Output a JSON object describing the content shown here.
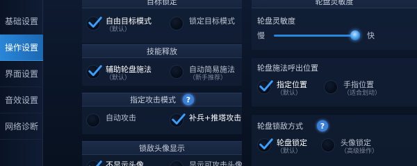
{
  "sidebar": {
    "items": [
      {
        "label": "基础设置",
        "active": false
      },
      {
        "label": "操作设置",
        "active": true
      },
      {
        "label": "界面设置",
        "active": false
      },
      {
        "label": "音效设置",
        "active": false
      },
      {
        "label": "网络诊断",
        "active": false
      }
    ]
  },
  "left": {
    "target_lock": {
      "title": "目标锁定",
      "options": [
        {
          "label": "自由目标模式",
          "sub": "（默认）",
          "checked": true
        },
        {
          "label": "锁定目标模式",
          "sub": "",
          "checked": false
        }
      ]
    },
    "skill_cast": {
      "title": "技能释放",
      "options": [
        {
          "label": "辅助轮盘施法",
          "sub": "（默认）",
          "checked": true
        },
        {
          "label": "自动简易施法",
          "sub": "（新手推荐）",
          "checked": false
        }
      ]
    },
    "attack_mode": {
      "title": "指定攻击模式",
      "help": "?",
      "options": [
        {
          "label": "自动攻击",
          "sub": "",
          "checked": false
        },
        {
          "label": "补兵+推塔攻击",
          "sub": "",
          "checked": true
        }
      ]
    },
    "enemy_avatar": {
      "title": "锁敌头像显示",
      "options": [
        {
          "label": "不显示头像",
          "checked": true
        },
        {
          "label": "显示可攻击头像",
          "checked": false
        }
      ]
    }
  },
  "right": {
    "wheel_sensitivity": {
      "title": "轮盘灵敏度",
      "label": "轮盘灵敏度",
      "slow_label": "慢",
      "fast_label": "快",
      "value": 0.93
    },
    "wheel_callout": {
      "title": "轮盘施法呼出位置",
      "options": [
        {
          "label": "指定位置",
          "sub": "（默认）",
          "checked": true
        },
        {
          "label": "手指位置",
          "sub": "（适合划动）",
          "checked": false
        }
      ]
    },
    "wheel_lock": {
      "title": "轮盘锁敌方式",
      "help": "?",
      "options": [
        {
          "label": "轮盘锁定",
          "sub": "（默认）",
          "checked": true
        },
        {
          "label": "头像锁定",
          "sub": "（高级操作）",
          "checked": false
        }
      ]
    }
  },
  "colors": {
    "accent": "#2a86d8",
    "check": "#3aa0ff",
    "background": "#0a1428"
  }
}
